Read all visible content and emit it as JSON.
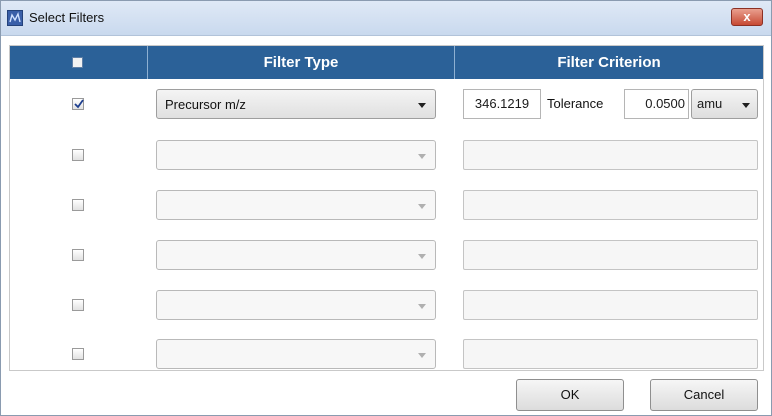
{
  "window": {
    "title": "Select Filters",
    "close_label": "x"
  },
  "header": {
    "filter_type": "Filter Type",
    "filter_criterion": "Filter Criterion"
  },
  "rows": [
    {
      "checked": true,
      "filter_type": "Precursor m/z",
      "criterion": {
        "value": "346.1219",
        "tolerance_label": "Tolerance",
        "tolerance": "0.0500",
        "unit": "amu"
      }
    },
    {
      "checked": false,
      "filter_type": ""
    },
    {
      "checked": false,
      "filter_type": ""
    },
    {
      "checked": false,
      "filter_type": ""
    },
    {
      "checked": false,
      "filter_type": ""
    },
    {
      "checked": false,
      "filter_type": ""
    }
  ],
  "buttons": {
    "ok": "OK",
    "cancel": "Cancel"
  },
  "colors": {
    "header_bg": "#2b6198",
    "titlebar": "#c9d9ee",
    "close_button": "#c74a34"
  }
}
